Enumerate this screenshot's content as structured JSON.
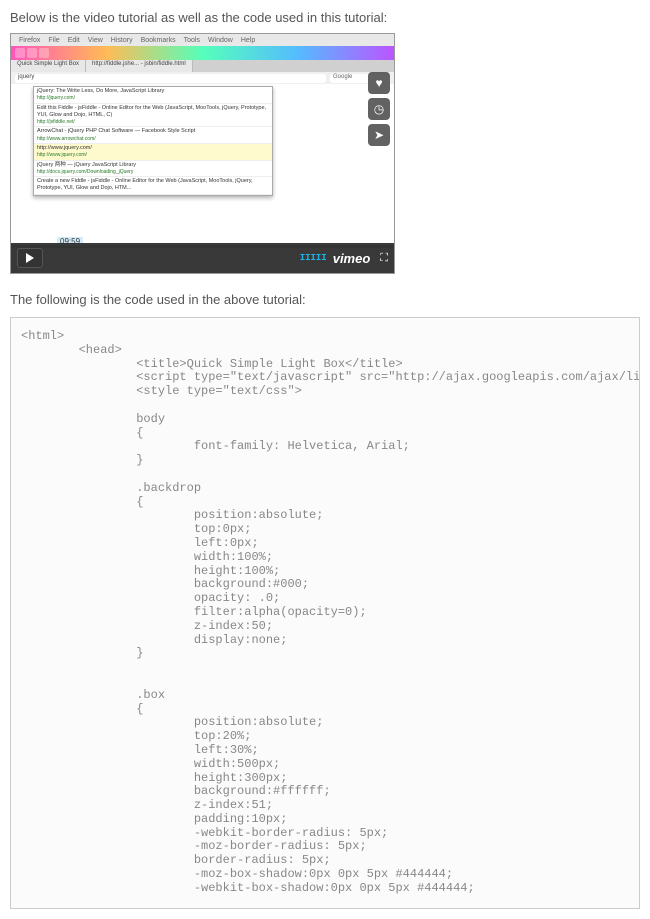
{
  "intro_text": "Below is the video tutorial as well as the code used in this tutorial:",
  "followup_text": "The following is the code used in the above tutorial:",
  "video": {
    "menubar": [
      "Firefox",
      "File",
      "Edit",
      "View",
      "History",
      "Bookmarks",
      "Tools",
      "Window",
      "Help"
    ],
    "tabs": [
      "Quick Simple Light Box",
      "http://fiddle.jshe... - jsbin/fiddle.html"
    ],
    "address": "jquery",
    "search_placeholder": "Google",
    "dropdown": [
      {
        "title": "jQuery: The Write Less, Do More, JavaScript Library",
        "url": "http://jquery.com/"
      },
      {
        "title": "Edit this Fiddle - jsFiddle - Online Editor for the Web (JavaScript, MooTools, jQuery, Prototype, YUI, Glow and Dojo, HTML, C)",
        "url": "http://jsfiddle.net/"
      },
      {
        "title": "ArrowChat - jQuery PHP Chat Software — Facebook Style Script",
        "url": "http://www.arrowchat.com/"
      },
      {
        "title": "http://www.jquery.com/",
        "url": "http://www.jquery.com/"
      },
      {
        "title": "jQuery 两种 — jQuery JavaScript Library",
        "url": "http://docs.jquery.com/Downloading_jQuery"
      },
      {
        "title": "Create a new Fiddle - jsFiddle - Online Editor for the Web (JavaScript, MooTools, jQuery, Prototype, YUI, Glow and Dojo, HTM...",
        "url": ""
      }
    ],
    "side_icons": [
      "heart-icon",
      "clock-icon",
      "share-icon"
    ],
    "time": "09:59",
    "brand": "vimeo"
  },
  "code": "<html>\n        <head>\n                <title>Quick Simple Light Box</title>\n                <script type=\"text/javascript\" src=\"http://ajax.googleapis.com/ajax/libs/jque\n                <style type=\"text/css\">\n                \n                body\n                {\n                        font-family: Helvetica, Arial;\n                }\n                \n                .backdrop\n                {\n                        position:absolute;\n                        top:0px;\n                        left:0px;\n                        width:100%;\n                        height:100%;\n                        background:#000;\n                        opacity: .0;\n                        filter:alpha(opacity=0);\n                        z-index:50;\n                        display:none;\n                }\n                \n                \n                .box\n                {\n                        position:absolute;\n                        top:20%;\n                        left:30%;\n                        width:500px;\n                        height:300px;\n                        background:#ffffff;\n                        z-index:51;\n                        padding:10px;\n                        -webkit-border-radius: 5px;\n                        -moz-border-radius: 5px;\n                        border-radius: 5px;\n                        -moz-box-shadow:0px 0px 5px #444444;\n                        -webkit-box-shadow:0px 0px 5px #444444;"
}
